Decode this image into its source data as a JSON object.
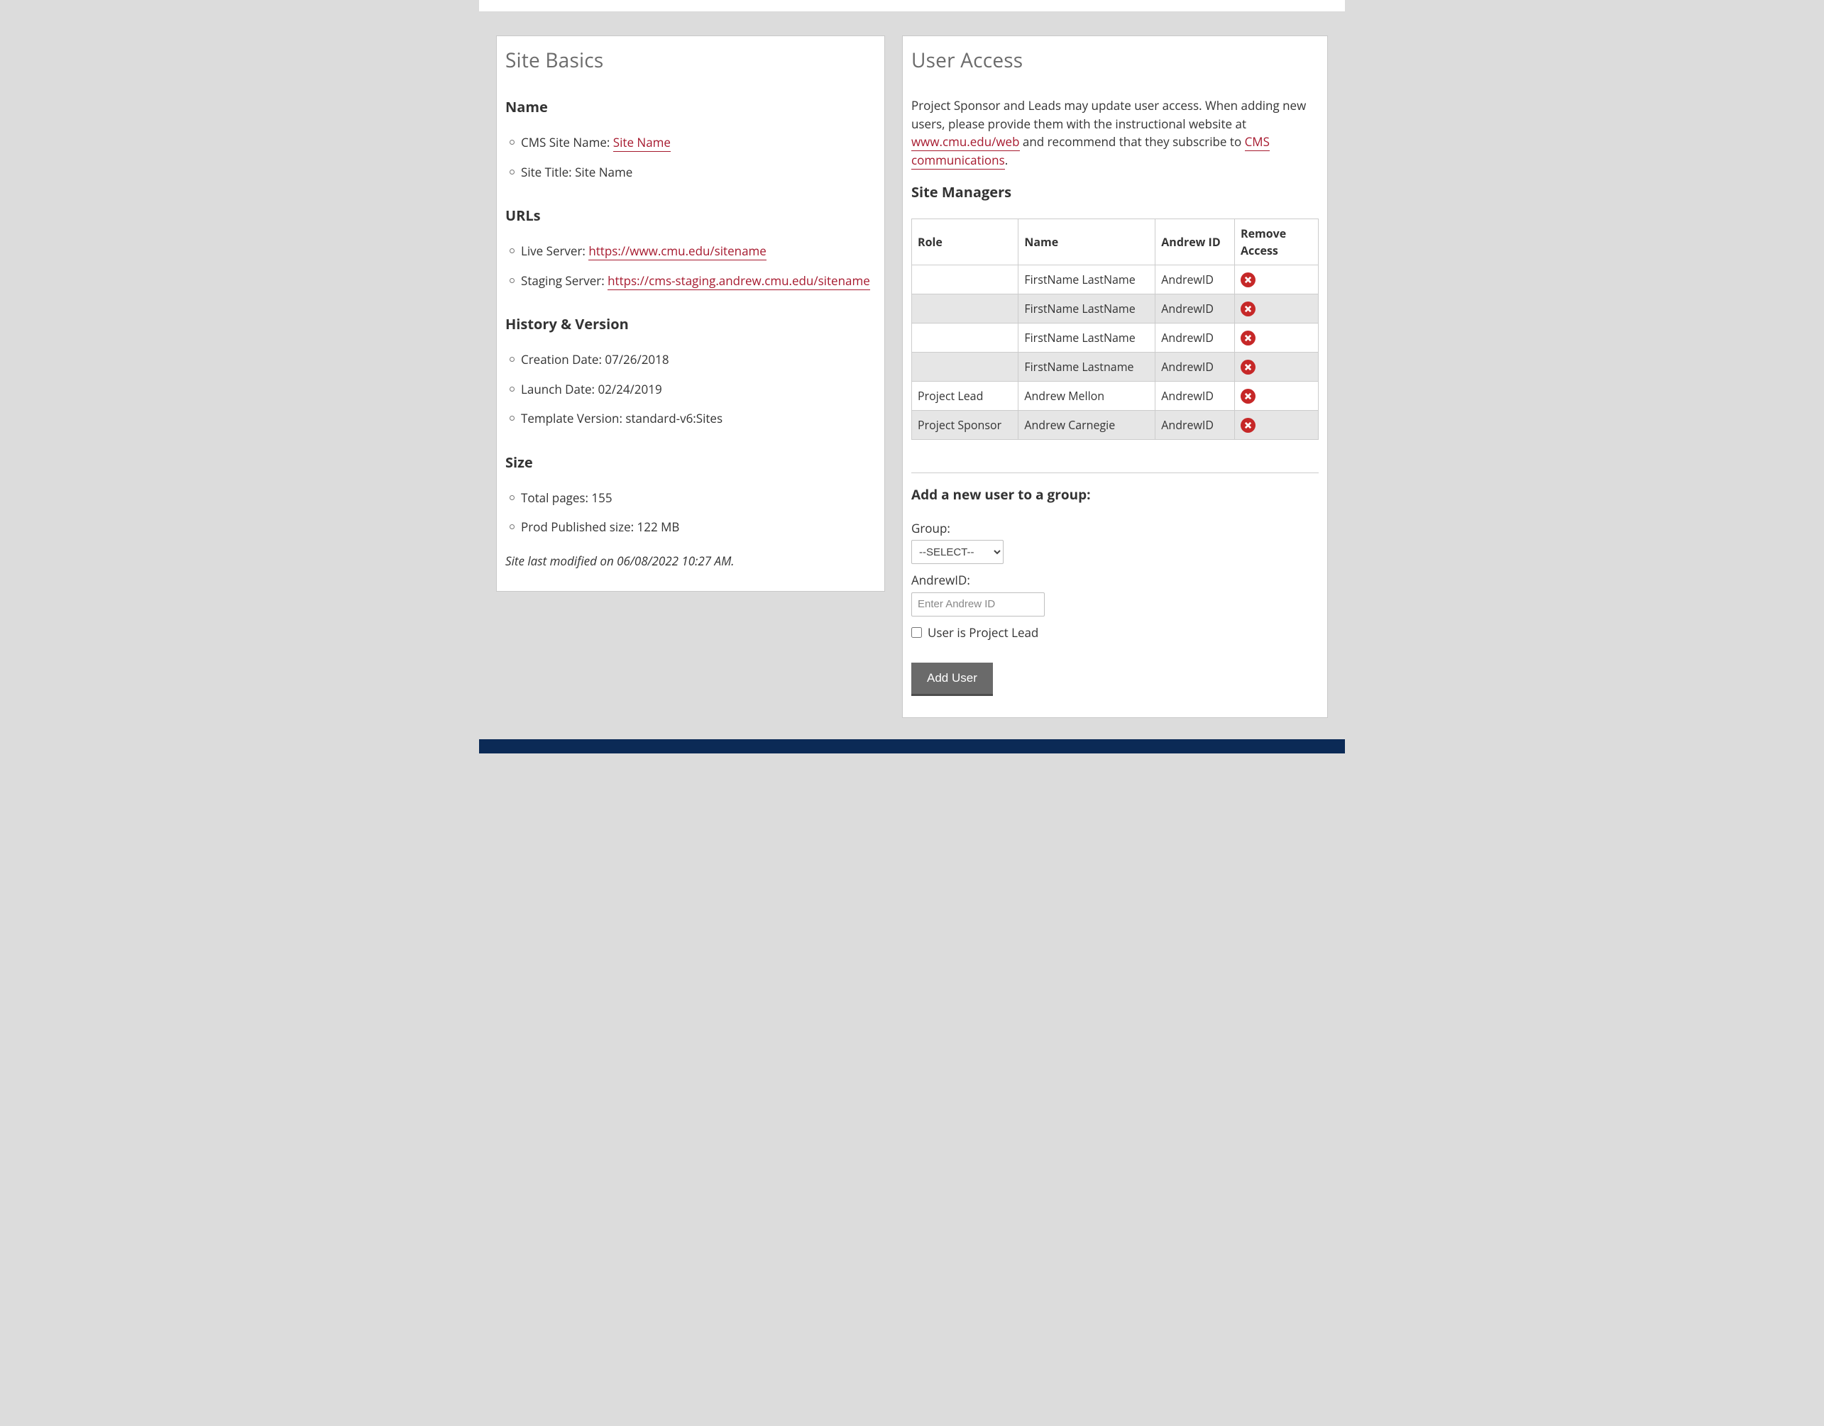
{
  "siteBasics": {
    "title": "Site Basics",
    "name": {
      "heading": "Name",
      "cmsLabel": "CMS Site Name: ",
      "cmsLink": "Site Name",
      "titleLabel": "Site Title: ",
      "titleValue": "Site Name"
    },
    "urls": {
      "heading": "URLs",
      "liveLabel": "Live Server: ",
      "liveLink": "https://www.cmu.edu/sitename",
      "stagingLabel": "Staging Server: ",
      "stagingLink": "https://cms-staging.andrew.cmu.edu/sitename"
    },
    "history": {
      "heading": "History & Version",
      "creationLabel": "Creation Date: ",
      "creationValue": "07/26/2018",
      "launchLabel": "Launch Date: ",
      "launchValue": "02/24/2019",
      "templateLabel": "Template Version: ",
      "templateValue": "standard-v6:Sites"
    },
    "size": {
      "heading": "Size",
      "pagesLabel": "Total pages: ",
      "pagesValue": "155",
      "prodLabel": "Prod Published size: ",
      "prodValue": "122 MB"
    },
    "lastModified": "Site last modified on 06/08/2022 10:27 AM."
  },
  "userAccess": {
    "title": "User Access",
    "descPre": "Project Sponsor and Leads may update user access. When adding new users, please provide them with the instructional website at ",
    "link1": "www.cmu.edu/web",
    "descMid": " and recommend that they subscribe to ",
    "link2": "CMS communications",
    "descEnd": ".",
    "managersHeading": "Site Managers",
    "tableHeaders": {
      "role": "Role",
      "name": "Name",
      "andrew": "Andrew ID",
      "remove": "Remove Access"
    },
    "managers": [
      {
        "role": "",
        "name": "FirstName LastName",
        "andrew": "AndrewID"
      },
      {
        "role": "",
        "name": "FirstName LastName",
        "andrew": "AndrewID"
      },
      {
        "role": "",
        "name": "FirstName LastName",
        "andrew": "AndrewID"
      },
      {
        "role": "",
        "name": "FirstName Lastname",
        "andrew": "AndrewID"
      },
      {
        "role": "Project Lead",
        "name": "Andrew Mellon",
        "andrew": "AndrewID"
      },
      {
        "role": "Project Sponsor",
        "name": "Andrew Carnegie",
        "andrew": "AndrewID"
      }
    ],
    "addUser": {
      "heading": "Add a new user to a group:",
      "groupLabel": "Group:",
      "groupPlaceholder": "--SELECT--",
      "andrewLabel": "AndrewID:",
      "andrewPlaceholder": "Enter Andrew ID",
      "leadCheckbox": "User is Project Lead",
      "button": "Add User"
    }
  }
}
